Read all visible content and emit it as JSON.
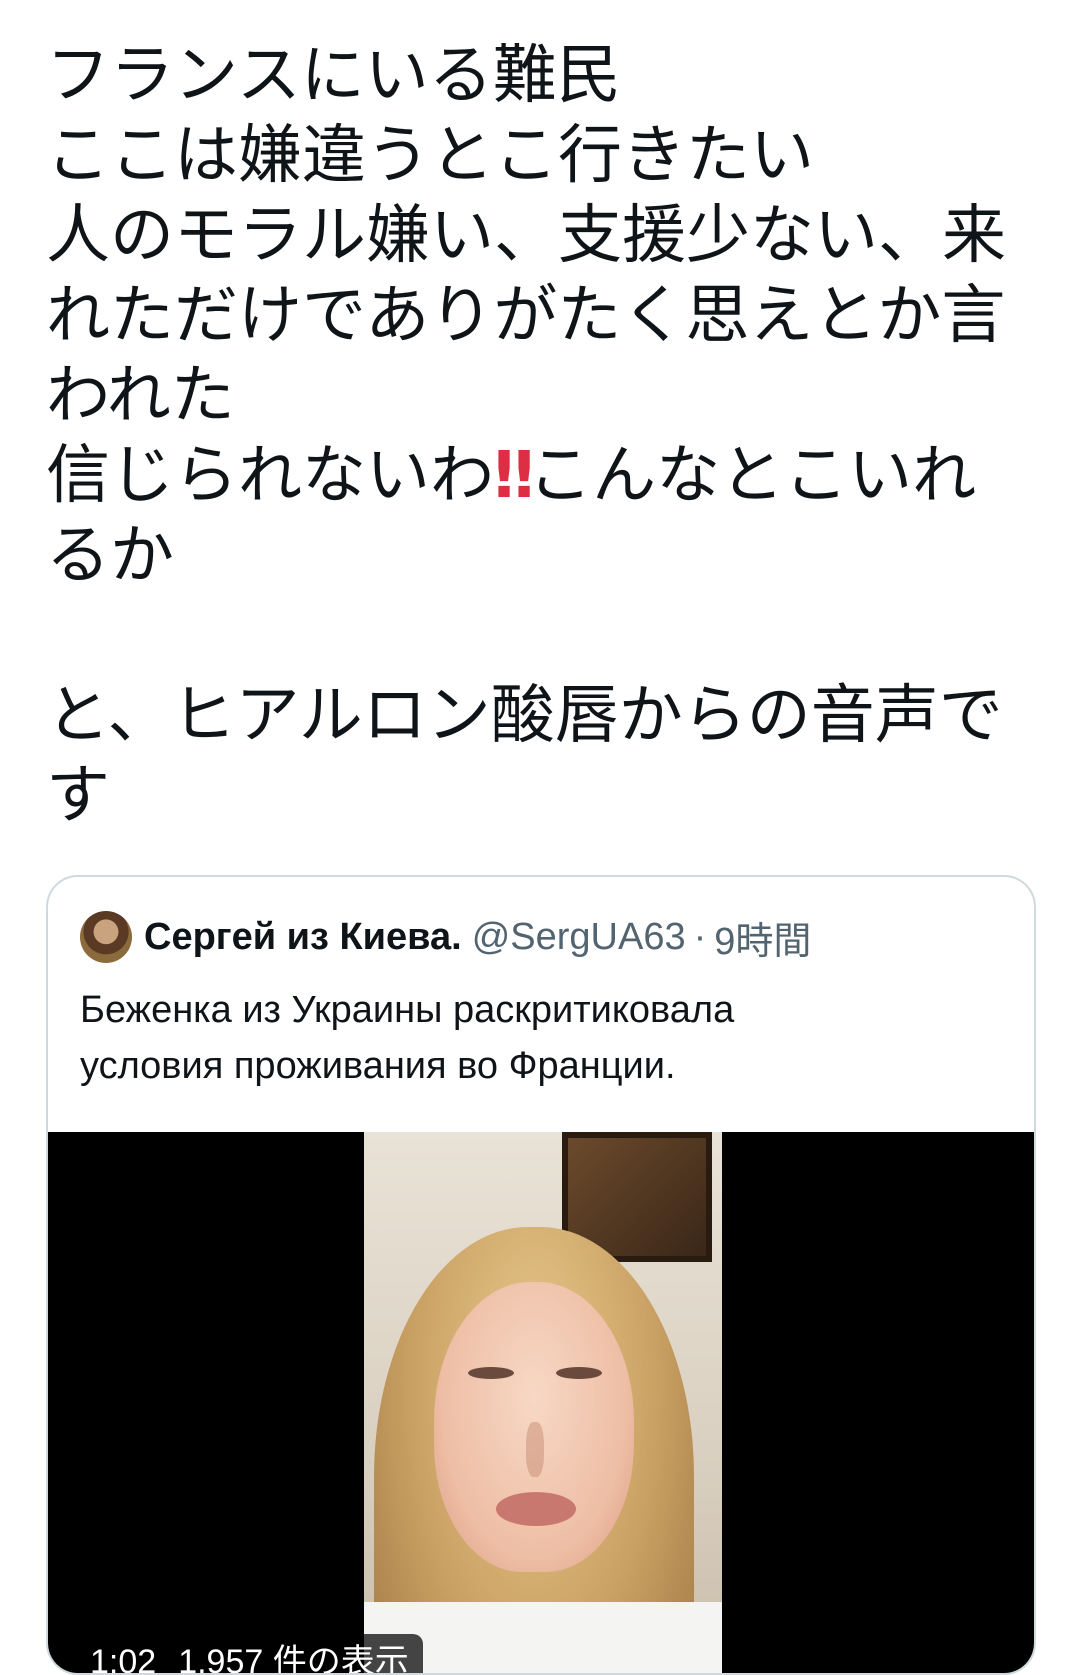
{
  "tweet": {
    "lines": [
      "フランスにいる難民",
      "ここは嫌違うとこ行きたい",
      "人のモラル嫌い、支援少ない、来",
      "れただけでありがたく思えとか言",
      "われた",
      "信じられないわ",
      "こんなとこいれ",
      "るか",
      "と、ヒアルロン酸唇からの音声で",
      "す"
    ],
    "emoji": "‼"
  },
  "quoted_tweet": {
    "author_name": "Сергей из Киева.",
    "handle": "@SergUA63",
    "separator": "·",
    "time": "9時間",
    "text_lines": [
      "Беженка из Украины раскритиковала",
      "условия проживания во Франции."
    ],
    "video": {
      "duration": "1:02",
      "views": "1,957 件の表示"
    }
  },
  "colors": {
    "text": "#0f1419",
    "secondary": "#536471",
    "border": "#cfd9de",
    "emoji_red": "#dd2e44"
  }
}
